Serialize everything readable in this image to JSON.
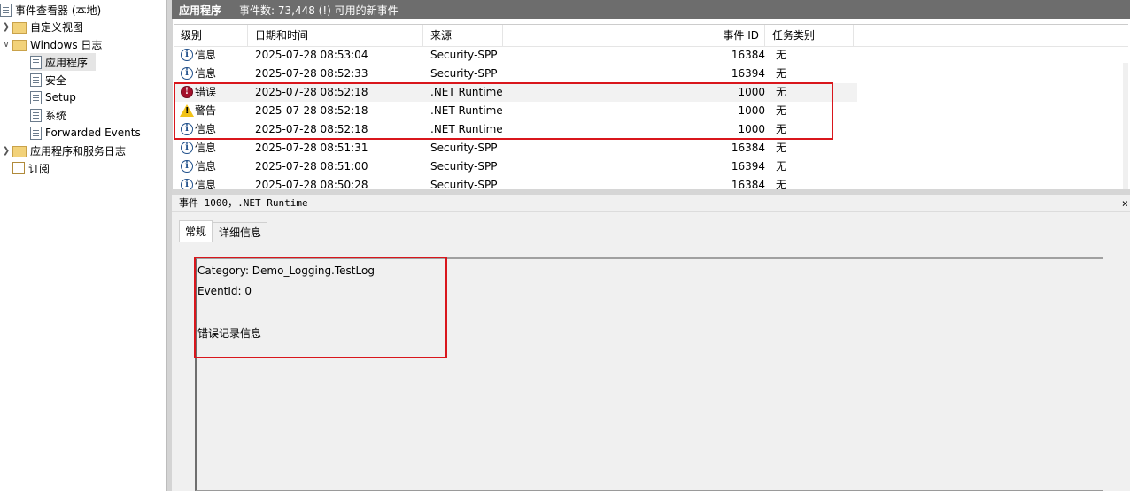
{
  "tree": {
    "root": "事件查看器 (本地)",
    "items": [
      {
        "label": "自定义视图"
      },
      {
        "label": "Windows 日志"
      },
      {
        "label": "应用程序"
      },
      {
        "label": "安全"
      },
      {
        "label": "Setup"
      },
      {
        "label": "系统"
      },
      {
        "label": "Forwarded Events"
      },
      {
        "label": "应用程序和服务日志"
      },
      {
        "label": "订阅"
      }
    ]
  },
  "header": {
    "title": "应用程序",
    "count": "事件数: 73,448 (!) 可用的新事件"
  },
  "columns": [
    "级别",
    "日期和时间",
    "来源",
    "事件 ID",
    "任务类别"
  ],
  "rows": [
    {
      "level": "信息",
      "datetime": "2025-07-28 08:53:04",
      "source": "Security-SPP",
      "id": "16384",
      "task": "无"
    },
    {
      "level": "信息",
      "datetime": "2025-07-28 08:52:33",
      "source": "Security-SPP",
      "id": "16394",
      "task": "无"
    },
    {
      "level": "错误",
      "datetime": "2025-07-28 08:52:18",
      "source": ".NET Runtime",
      "id": "1000",
      "task": "无"
    },
    {
      "level": "警告",
      "datetime": "2025-07-28 08:52:18",
      "source": ".NET Runtime",
      "id": "1000",
      "task": "无"
    },
    {
      "level": "信息",
      "datetime": "2025-07-28 08:52:18",
      "source": ".NET Runtime",
      "id": "1000",
      "task": "无"
    },
    {
      "level": "信息",
      "datetime": "2025-07-28 08:51:31",
      "source": "Security-SPP",
      "id": "16384",
      "task": "无"
    },
    {
      "level": "信息",
      "datetime": "2025-07-28 08:51:00",
      "source": "Security-SPP",
      "id": "16394",
      "task": "无"
    },
    {
      "level": "信息",
      "datetime": "2025-07-28 08:50:28",
      "source": "Security-SPP",
      "id": "16384",
      "task": "无"
    }
  ],
  "detail": {
    "header": "事件 1000，.NET Runtime",
    "close": "×",
    "tabs": [
      "常规",
      "详细信息"
    ],
    "lines": [
      "Category: Demo_Logging.TestLog",
      "EventId: 0",
      "错误记录信息"
    ]
  },
  "colors": {
    "accent_red": "#d9161c",
    "header_bg": "#6d6d6d"
  }
}
